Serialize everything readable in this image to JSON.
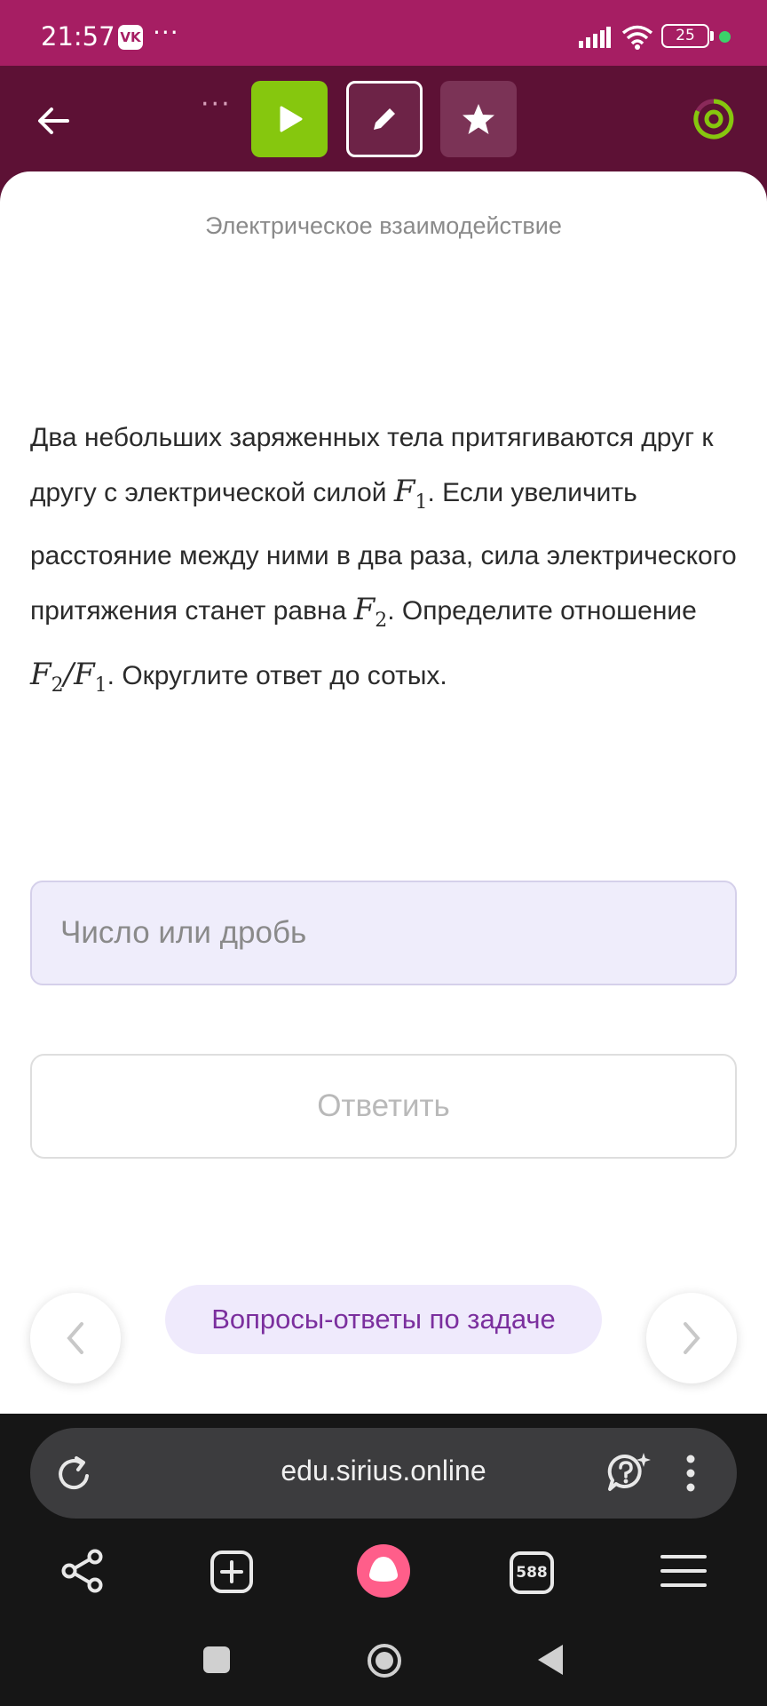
{
  "status_bar": {
    "time": "21:57",
    "app_badge": "VK",
    "more": "···",
    "battery": "25"
  },
  "toolbar": {
    "more": "···",
    "icons": [
      "back-arrow-icon",
      "play-icon",
      "pencil-icon",
      "star-icon",
      "progress-ring-icon"
    ]
  },
  "task": {
    "topic": "Электрическое взаимодействие",
    "text_1": "Два небольших заряженных тела притягиваются друг к другу с электрической силой ",
    "text_2": ". Если увеличить расстояние между ними в два раза, сила электрического притяжения станет равна ",
    "text_3": ". Определите отношение ",
    "text_4": ". Округлите ответ до сотых.",
    "symbol_F": "F",
    "sub_1": "1",
    "sub_2": "2",
    "slash": "/"
  },
  "answer": {
    "placeholder": "Число или дробь",
    "value": "",
    "submit_label": "Ответить"
  },
  "navigation": {
    "prev": "‹",
    "next": "›",
    "qa_label": "Вопросы-ответы по задаче"
  },
  "browser": {
    "url": "edu.sirius.online",
    "tabs_count": "588"
  },
  "colors": {
    "status_bar": "#a61e63",
    "toolbar": "#5d1135",
    "play_button": "#86c70e",
    "input_bg": "#efedfb",
    "qa_text": "#7b2f9e",
    "alice": "#ff5e8a"
  }
}
